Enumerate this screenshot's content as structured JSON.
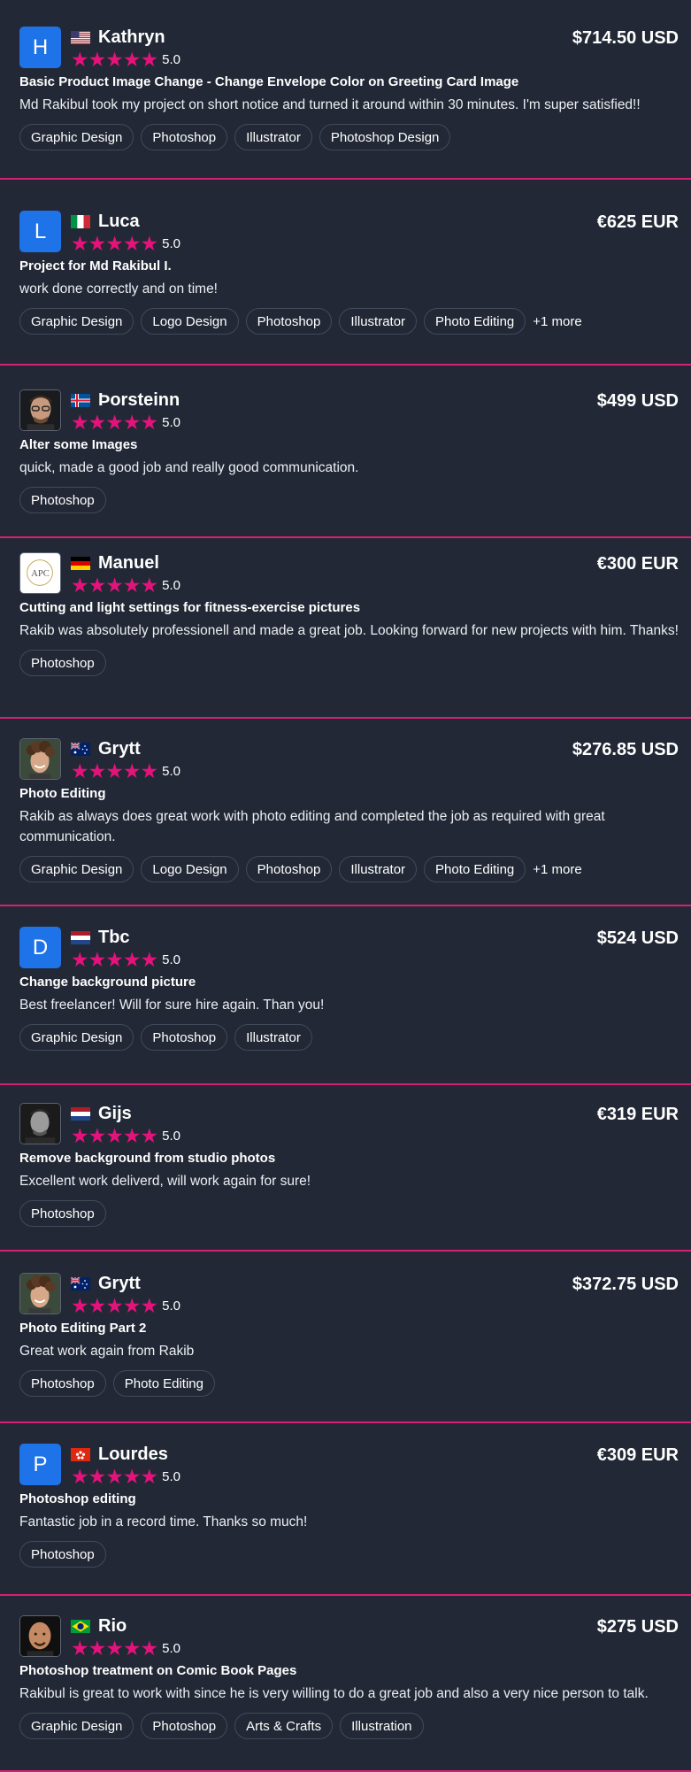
{
  "reviews": [
    {
      "name": "Kathryn",
      "flag": "us",
      "avatar": {
        "type": "letter",
        "letter": "H"
      },
      "rating": "5.0",
      "price": "$714.50 USD",
      "title": "Basic Product Image Change - Change Envelope Color on Greeting Card Image",
      "text": "Md Rakibul took my project on short notice and turned it around within 30 minutes. I'm super satisfied!!",
      "tags": [
        "Graphic Design",
        "Photoshop",
        "Illustrator",
        "Photoshop Design"
      ],
      "more": ""
    },
    {
      "name": "Luca",
      "flag": "it",
      "avatar": {
        "type": "letter",
        "letter": "L"
      },
      "rating": "5.0",
      "price": "€625 EUR",
      "title": "Project for Md Rakibul I.",
      "text": "work done correctly and on time!",
      "tags": [
        "Graphic Design",
        "Logo Design",
        "Photoshop",
        "Illustrator",
        "Photo Editing"
      ],
      "more": "+1 more"
    },
    {
      "name": "Þorsteinn",
      "flag": "is",
      "avatar": {
        "type": "photo",
        "icon": "man-glasses-avatar"
      },
      "rating": "5.0",
      "price": "$499 USD",
      "title": "Alter some Images",
      "text": "quick, made a good job and really good communication.",
      "tags": [
        "Photoshop"
      ],
      "more": ""
    },
    {
      "name": "Manuel",
      "flag": "de",
      "avatar": {
        "type": "photo",
        "icon": "apc-logo-avatar"
      },
      "rating": "5.0",
      "price": "€300 EUR",
      "title": "Cutting and light settings for fitness-exercise pictures",
      "text": "Rakib was absolutely professionell and made a great job. Looking forward for new projects with him. Thanks!",
      "tags": [
        "Photoshop"
      ],
      "more": ""
    },
    {
      "name": "Grytt",
      "flag": "au",
      "avatar": {
        "type": "photo",
        "icon": "curly-hair-man-avatar"
      },
      "rating": "5.0",
      "price": "$276.85 USD",
      "title": "Photo Editing",
      "text": "Rakib as always does great work with photo editing and completed the job as required with great communication.",
      "tags": [
        "Graphic Design",
        "Logo Design",
        "Photoshop",
        "Illustrator",
        "Photo Editing"
      ],
      "more": "+1 more"
    },
    {
      "name": "Tbc",
      "flag": "nl",
      "avatar": {
        "type": "letter",
        "letter": "D"
      },
      "rating": "5.0",
      "price": "$524 USD",
      "title": "Change background picture",
      "text": "Best freelancer! Will for sure hire again. Than you!",
      "tags": [
        "Graphic Design",
        "Photoshop",
        "Illustrator"
      ],
      "more": ""
    },
    {
      "name": "Gijs",
      "flag": "nl",
      "avatar": {
        "type": "photo",
        "icon": "bw-portrait-avatar"
      },
      "rating": "5.0",
      "price": "€319 EUR",
      "title": "Remove background from studio photos",
      "text": "Excellent work deliverd, will work again for sure!",
      "tags": [
        "Photoshop"
      ],
      "more": ""
    },
    {
      "name": "Grytt",
      "flag": "au",
      "avatar": {
        "type": "photo",
        "icon": "curly-hair-man-avatar"
      },
      "rating": "5.0",
      "price": "$372.75 USD",
      "title": "Photo Editing Part 2",
      "text": "Great work again from Rakib",
      "tags": [
        "Photoshop",
        "Photo Editing"
      ],
      "more": ""
    },
    {
      "name": "Lourdes",
      "flag": "hk",
      "avatar": {
        "type": "letter",
        "letter": "P"
      },
      "rating": "5.0",
      "price": "€309 EUR",
      "title": "Photoshop editing",
      "text": "Fantastic job in a record time. Thanks so much!",
      "tags": [
        "Photoshop"
      ],
      "more": ""
    },
    {
      "name": "Rio",
      "flag": "br",
      "avatar": {
        "type": "photo",
        "icon": "bald-man-avatar"
      },
      "rating": "5.0",
      "price": "$275 USD",
      "title": "Photoshop treatment on Comic Book Pages",
      "text": "Rakibul is great to work with since he is very willing to do a great job and also a very nice person to talk.",
      "tags": [
        "Graphic Design",
        "Photoshop",
        "Arts & Crafts",
        "Illustration"
      ],
      "more": ""
    }
  ],
  "colors": {
    "background": "#222835",
    "divider": "#d71f76",
    "star": "#e3137b",
    "avatar_letter_bg": "#1f73e8",
    "tag_border": "#434a58"
  }
}
